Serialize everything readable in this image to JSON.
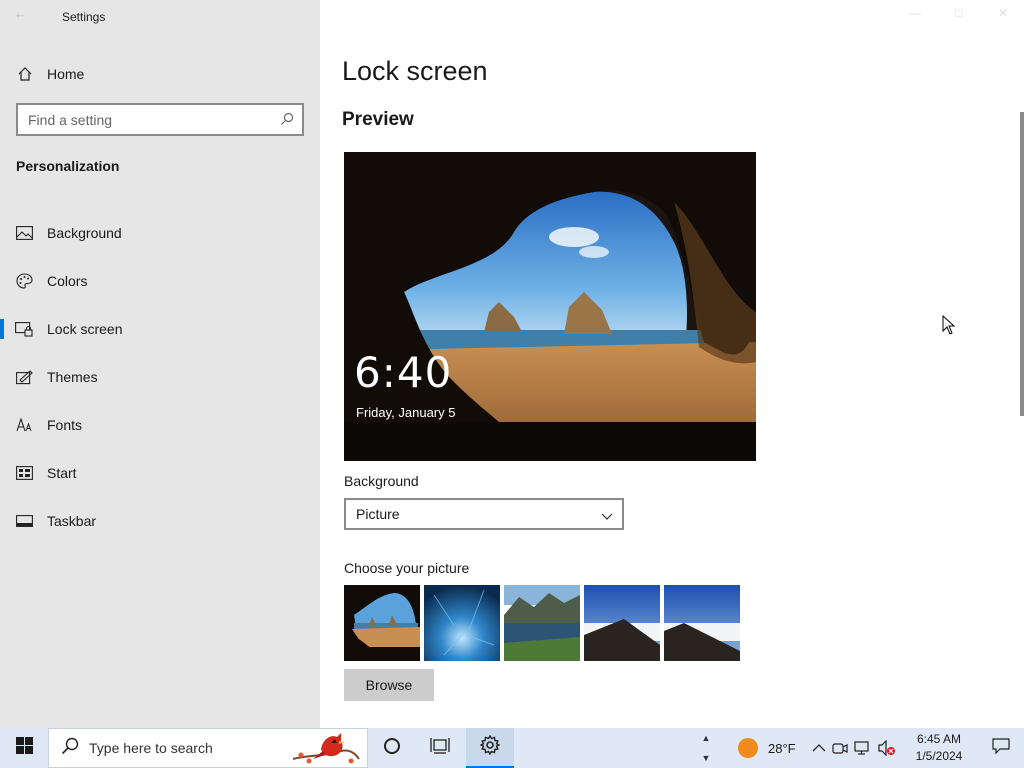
{
  "window": {
    "title": "Settings"
  },
  "sidebar": {
    "home_label": "Home",
    "search_placeholder": "Find a setting",
    "section_title": "Personalization",
    "items": [
      {
        "label": "Background",
        "icon": "image-icon"
      },
      {
        "label": "Colors",
        "icon": "palette-icon"
      },
      {
        "label": "Lock screen",
        "icon": "lock-screen-icon",
        "selected": true
      },
      {
        "label": "Themes",
        "icon": "themes-icon"
      },
      {
        "label": "Fonts",
        "icon": "fonts-icon"
      },
      {
        "label": "Start",
        "icon": "start-icon"
      },
      {
        "label": "Taskbar",
        "icon": "taskbar-icon"
      }
    ]
  },
  "main": {
    "page_title": "Lock screen",
    "preview_title": "Preview",
    "preview_time": "6:40",
    "preview_date": "Friday, January 5",
    "background_label": "Background",
    "background_value": "Picture",
    "choose_label": "Choose your picture",
    "thumbnails": [
      "cave-beach",
      "underwater-ice",
      "mountain-lake",
      "snowy-ridge",
      "snowy-ridge-alt"
    ],
    "browse_label": "Browse"
  },
  "taskbar": {
    "search_text": "Type here to search",
    "temperature": "28°F",
    "time": "6:45 AM",
    "date": "1/5/2024"
  },
  "colors": {
    "accent": "#0078d7",
    "sidebar_bg": "#e6e6e6",
    "taskbar_bg": "#dfe9f5"
  }
}
